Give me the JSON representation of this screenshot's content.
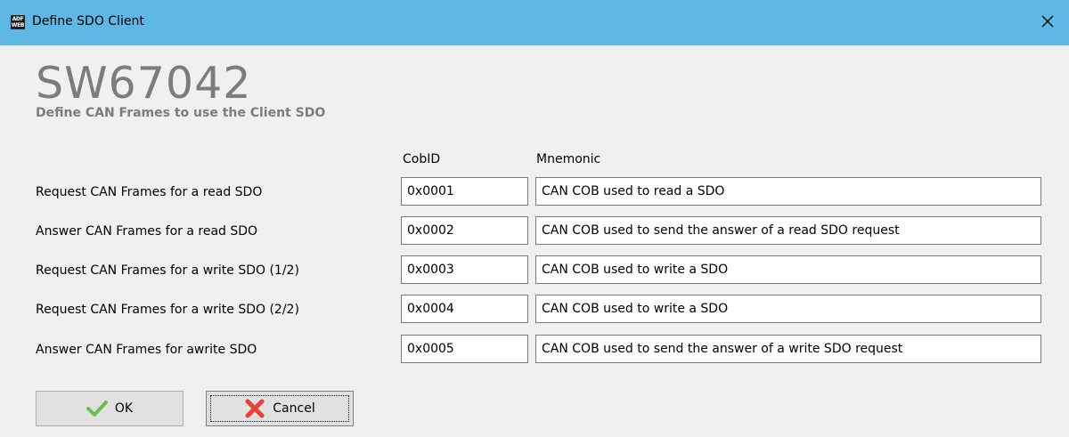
{
  "window": {
    "title": "Define SDO Client",
    "icon_text_top": "ADF",
    "icon_text_bottom": "WEB"
  },
  "header": {
    "brand": "SW67042",
    "subtitle": "Define CAN Frames to use the Client SDO"
  },
  "columns": {
    "cobid": "CobID",
    "mnemonic": "Mnemonic"
  },
  "rows": [
    {
      "label": "Request CAN Frames for a read SDO",
      "cobid": "0x0001",
      "mnemonic": "CAN COB used to read a SDO"
    },
    {
      "label": "Answer CAN Frames for a read SDO",
      "cobid": "0x0002",
      "mnemonic": "CAN COB used to send the answer of a read SDO request"
    },
    {
      "label": "Request CAN Frames for a write SDO (1/2)",
      "cobid": "0x0003",
      "mnemonic": "CAN COB used to write a SDO"
    },
    {
      "label": "Request CAN Frames for a write SDO (2/2)",
      "cobid": "0x0004",
      "mnemonic": "CAN COB used to write a SDO"
    },
    {
      "label": "Answer CAN Frames for awrite SDO",
      "cobid": "0x0005",
      "mnemonic": "CAN COB used to send the answer of a write SDO request"
    }
  ],
  "buttons": {
    "ok_label": "OK",
    "cancel_label": "Cancel"
  },
  "colors": {
    "titlebar": "#5fb7e5",
    "ok_check": "#6cc04a",
    "cancel_x": "#e8423a",
    "brand_text": "#7c7c7c"
  },
  "icons": {
    "close": "close-icon",
    "ok": "check-icon",
    "cancel": "cross-icon"
  }
}
